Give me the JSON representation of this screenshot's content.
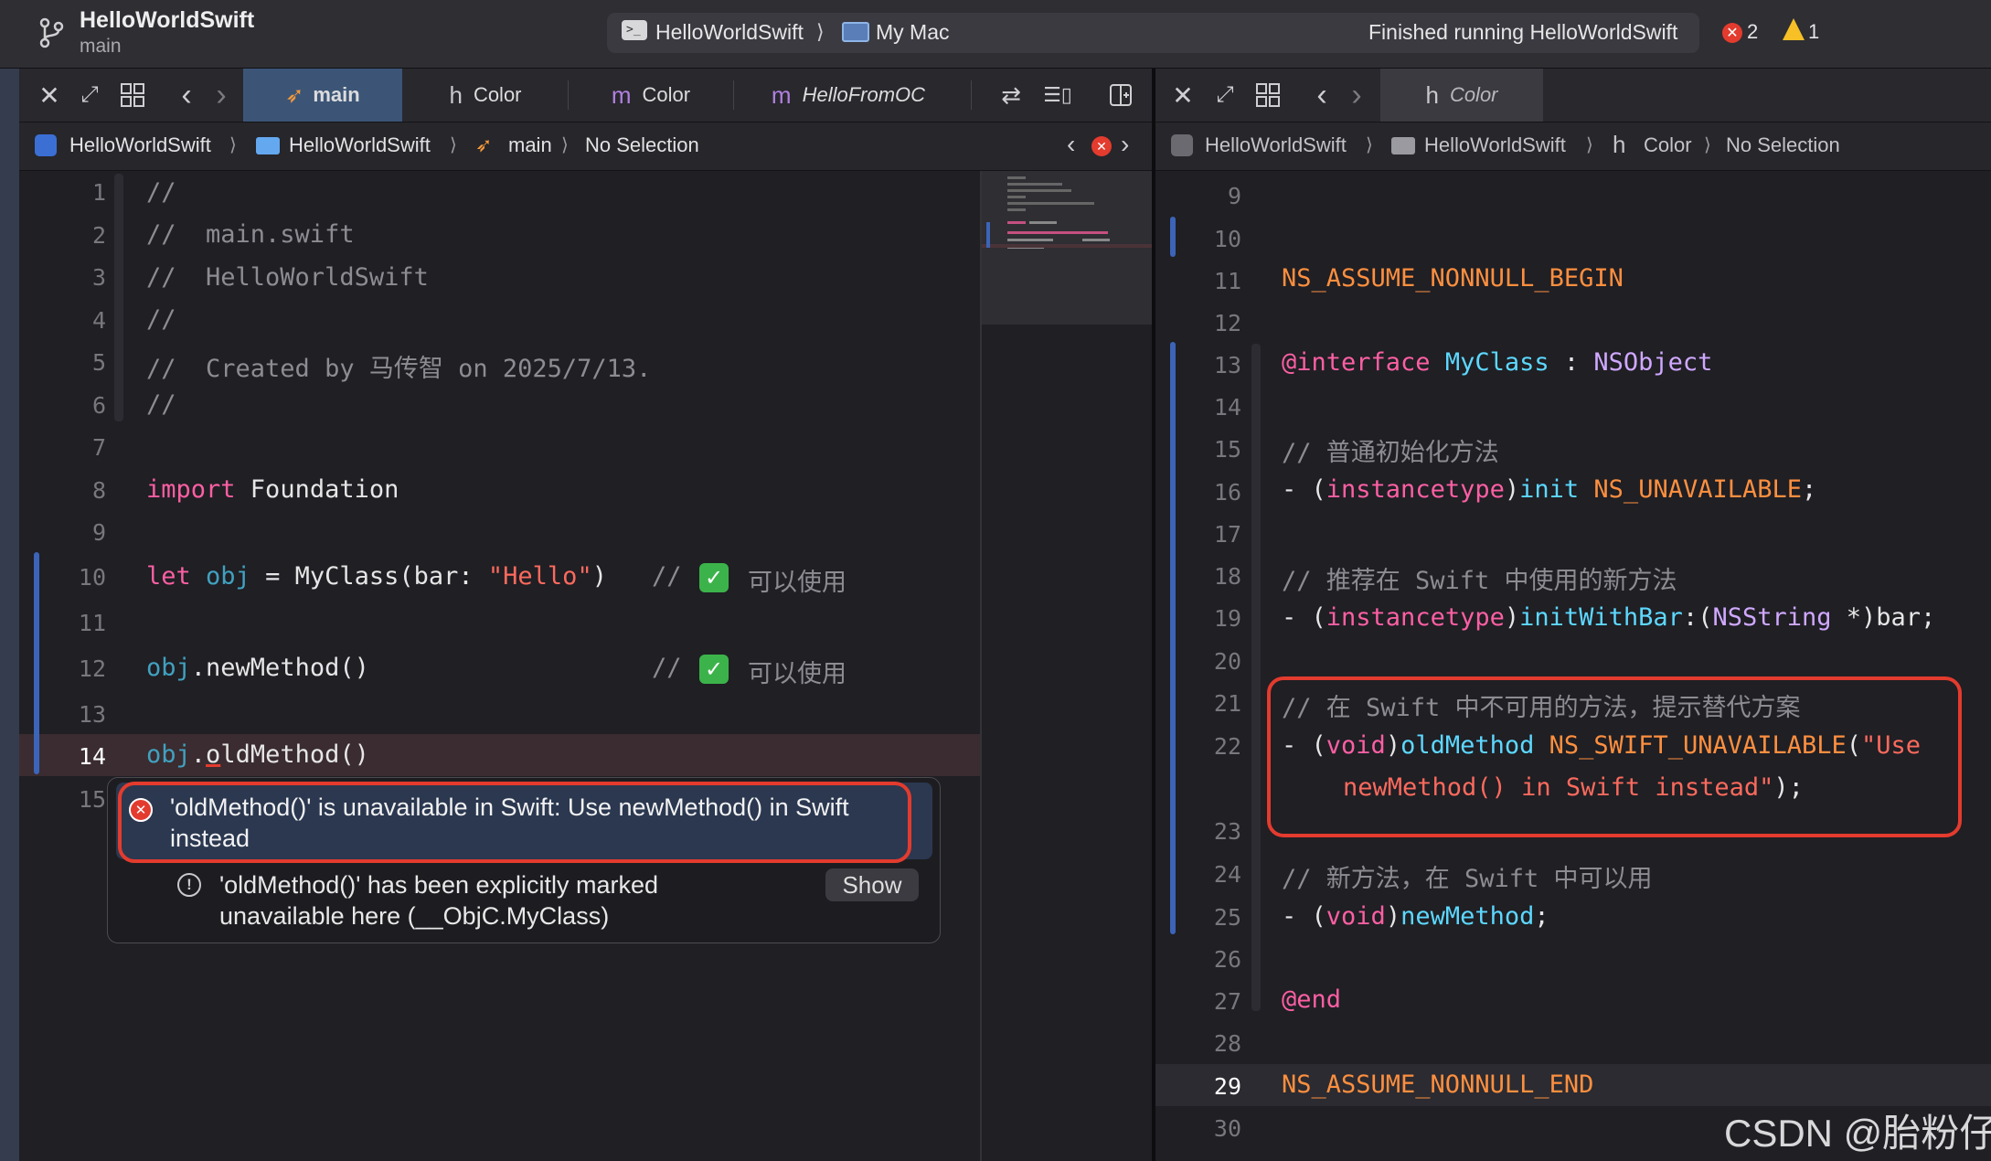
{
  "titlebar": {
    "project": "HelloWorldSwift",
    "branch": "main",
    "scheme": "HelloWorldSwift",
    "destination": "My Mac",
    "status": "Finished running HelloWorldSwift",
    "errors": "2",
    "warnings": "1"
  },
  "left_tabs": [
    {
      "icon": "swift",
      "label": "main"
    },
    {
      "icon": "h",
      "label": "Color"
    },
    {
      "icon": "m",
      "label": "Color"
    },
    {
      "icon": "m",
      "label": "HelloFromOC"
    }
  ],
  "left_jump": [
    "HelloWorldSwift",
    "HelloWorldSwift",
    "main",
    "No Selection"
  ],
  "right_tab": {
    "icon": "h",
    "label": "Color"
  },
  "right_jump": [
    "HelloWorldSwift",
    "HelloWorldSwift",
    "Color",
    "No Selection"
  ],
  "left_lines": [
    "1",
    "2",
    "3",
    "4",
    "5",
    "6",
    "7",
    "8",
    "9",
    "10",
    "11",
    "12",
    "13",
    "14",
    "15"
  ],
  "left_code": {
    "l1": "//",
    "l2": "//  main.swift",
    "l3": "//  HelloWorldSwift",
    "l4": "//",
    "l5": "//  Created by 马传智 on 2025/7/13.",
    "l6": "//",
    "l8_kw": "import",
    "l8_rest": " Foundation",
    "l10_kw": "let",
    "l10_var": " obj",
    "l10_mid": " = MyClass(bar: ",
    "l10_str": "\"Hello\"",
    "l10_end": ")",
    "l10_cmt": "//",
    "l10_cmt2": "可以使用",
    "l12_var": "obj",
    "l12_rest": ".newMethod()",
    "l12_cmt": "//",
    "l12_cmt2": "可以使用",
    "l14_var": "obj",
    "l14_dot": ".",
    "l14_o": "o",
    "l14_rest": "ldMethod()"
  },
  "popup": {
    "error": "'oldMethod()' is unavailable in Swift: Use newMethod() in Swift instead",
    "note": "'oldMethod()' has been explicitly marked unavailable here (__ObjC.MyClass)",
    "show": "Show"
  },
  "right_lines": [
    "9",
    "10",
    "11",
    "12",
    "13",
    "14",
    "15",
    "16",
    "17",
    "18",
    "19",
    "20",
    "21",
    "22",
    "23",
    "24",
    "25",
    "26",
    "27",
    "28",
    "29",
    "30"
  ],
  "right_code": {
    "l11": "NS_ASSUME_NONNULL_BEGIN",
    "l13_kw": "@interface",
    "l13_cls": " MyClass",
    "l13_mid": " : ",
    "l13_sup": "NSObject",
    "l15": "// 普通初始化方法",
    "l16_a": "- (",
    "l16_kw": "instancetype",
    "l16_b": ")",
    "l16_fn": "init",
    "l16_c": " ",
    "l16_pp": "NS_UNAVAILABLE",
    "l16_d": ";",
    "l18": "// 推荐在 Swift 中使用的新方法",
    "l19_a": "- (",
    "l19_kw": "instancetype",
    "l19_b": ")",
    "l19_fn": "initWithBar",
    "l19_c": ":(",
    "l19_ty": "NSString",
    "l19_d": " *)bar;",
    "l21": "// 在 Swift 中不可用的方法，提示替代方案",
    "l22_a": "- (",
    "l22_kw": "void",
    "l22_b": ")",
    "l22_fn": "oldMethod",
    "l22_c": " ",
    "l22_pp": "NS_SWIFT_UNAVAILABLE",
    "l22_d": "(",
    "l22_str": "\"Use",
    "l22_str2": "newMethod() in Swift instead\"",
    "l22_e": ");",
    "l24": "// 新方法，在 Swift 中可以用",
    "l25_a": "- (",
    "l25_kw": "void",
    "l25_b": ")",
    "l25_fn": "newMethod",
    "l25_c": ";",
    "l27": "@end",
    "l29": "NS_ASSUME_NONNULL_END"
  },
  "watermark": "CSDN @胎粉仔",
  "colors": {
    "accent": "#3c5577",
    "error": "#e33b2e",
    "warning": "#f6c026",
    "check": "#3cb34a"
  }
}
